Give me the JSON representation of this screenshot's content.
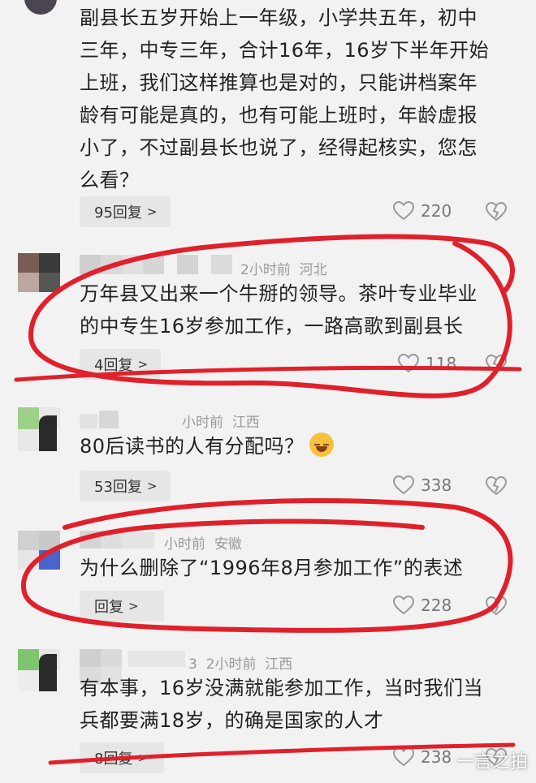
{
  "comments": [
    {
      "text_lines": [
        "副县长五岁开始上一年级，小学共五年，初中",
        "三年，中专三年，合计16年，16岁下半年开始",
        "上班，我们这样推算也是对的，只能讲档案年",
        "龄有可能是真的，也有可能上班时，年龄虚报",
        "小了，不过副县长也说了，经得起核实，您怎",
        "么看？"
      ],
      "reply_label": "95回复",
      "likes": "220"
    },
    {
      "time": "2小时前",
      "location": "河北",
      "text_lines": [
        "万年县又出来一个牛掰的领导。茶叶专业毕业",
        "的中专生16岁参加工作，一路高歌到副县长"
      ],
      "reply_label": "4回复",
      "likes": "118"
    },
    {
      "time": "小时前",
      "location": "江西",
      "text_lines": [
        "80后读书的人有分配吗？"
      ],
      "reply_label": "53回复",
      "likes": "338"
    },
    {
      "time": "小时前",
      "location": "安徽",
      "text_lines": [
        "为什么删除了“1996年8月参加工作”的表述"
      ],
      "reply_label": "回复",
      "likes": "228"
    },
    {
      "name_fragment": "3",
      "time": "2小时前",
      "location": "江西",
      "text_lines": [
        "有本事，16岁没满就能参加工作，当时我们当",
        "兵都要满18岁，的确是国家的人才"
      ],
      "reply_label": "8回复",
      "likes": "238"
    }
  ],
  "icons": {
    "like": "heart-outline-icon",
    "dislike": "broken-heart-icon",
    "chevron": "chevron-right-icon"
  },
  "colors": {
    "annotation": "#e0202a",
    "background": "#f2f2f2",
    "reply_bg": "#e6e6e6"
  },
  "watermark": "一言之拍"
}
